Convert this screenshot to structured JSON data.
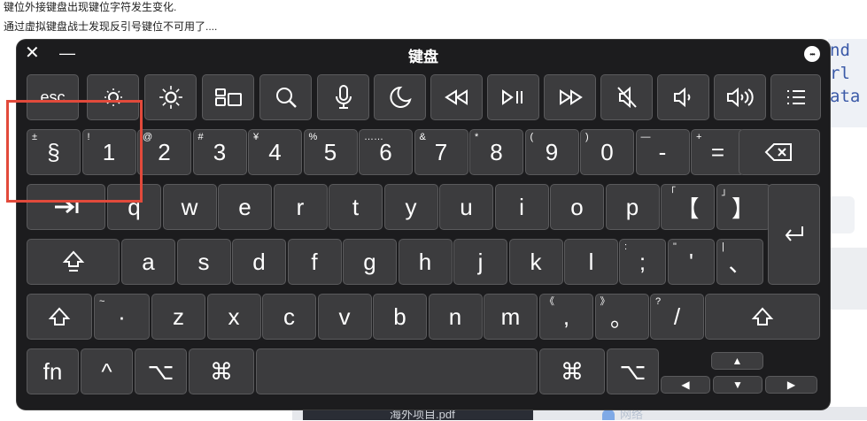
{
  "notes": [
    "键位外接键盘出现键位字符发生变化.",
    "通过虚拟键盘战士发现反引号键位不可用了...."
  ],
  "background": {
    "code_lines": [
      "nd",
      "rl",
      "ata"
    ],
    "bottom_text": "海外项目.pdf",
    "bottom_text2": "网络"
  },
  "keyboard": {
    "title": "键盘",
    "close": "✕",
    "minimize": "—",
    "options": "•••",
    "fn_row": [
      "esc",
      "brightness-down-icon",
      "brightness-up-icon",
      "mission-control-icon",
      "search-icon",
      "microphone-icon",
      "moon-icon",
      "rewind-icon",
      "play-pause-icon",
      "fast-forward-icon",
      "mute-icon",
      "volume-down-icon",
      "volume-up-icon",
      "list-icon"
    ],
    "row1": [
      {
        "sec": "±",
        "pri": "§"
      },
      {
        "sec": "!",
        "pri": "1"
      },
      {
        "sec": "@",
        "pri": "2"
      },
      {
        "sec": "#",
        "pri": "3"
      },
      {
        "sec": "¥",
        "pri": "4"
      },
      {
        "sec": "%",
        "pri": "5"
      },
      {
        "sec": "……",
        "pri": "6"
      },
      {
        "sec": "&",
        "pri": "7"
      },
      {
        "sec": "*",
        "pri": "8"
      },
      {
        "sec": "(",
        "pri": "9"
      },
      {
        "sec": ")",
        "pri": "0"
      },
      {
        "sec": "—",
        "pri": "-"
      },
      {
        "sec": "+",
        "pri": "="
      }
    ],
    "row2": [
      "q",
      "w",
      "e",
      "r",
      "t",
      "y",
      "u",
      "i",
      "o",
      "p"
    ],
    "row2_extra": [
      {
        "sec": "「",
        "pri": "【"
      },
      {
        "sec": "」",
        "pri": "】"
      }
    ],
    "row3": [
      "a",
      "s",
      "d",
      "f",
      "g",
      "h",
      "j",
      "k",
      "l"
    ],
    "row3_extra": [
      {
        "sec": ":",
        "pri": ";"
      },
      {
        "sec": "\"",
        "pri": "'"
      },
      {
        "sec": "|",
        "pri": "、"
      }
    ],
    "row4_first": {
      "sec": "~",
      "pri": "·"
    },
    "row4": [
      "z",
      "x",
      "c",
      "v",
      "b",
      "n",
      "m"
    ],
    "row4_extra": [
      {
        "sec": "《",
        "pri": ","
      },
      {
        "sec": "》",
        "pri": "。"
      },
      {
        "sec": "?",
        "pri": "/"
      }
    ],
    "fn": "fn",
    "ctrl": "^",
    "option": "⌥",
    "command": "⌘",
    "arrows": {
      "up": "▲",
      "left": "◀",
      "down": "▼",
      "right": "▶"
    }
  }
}
